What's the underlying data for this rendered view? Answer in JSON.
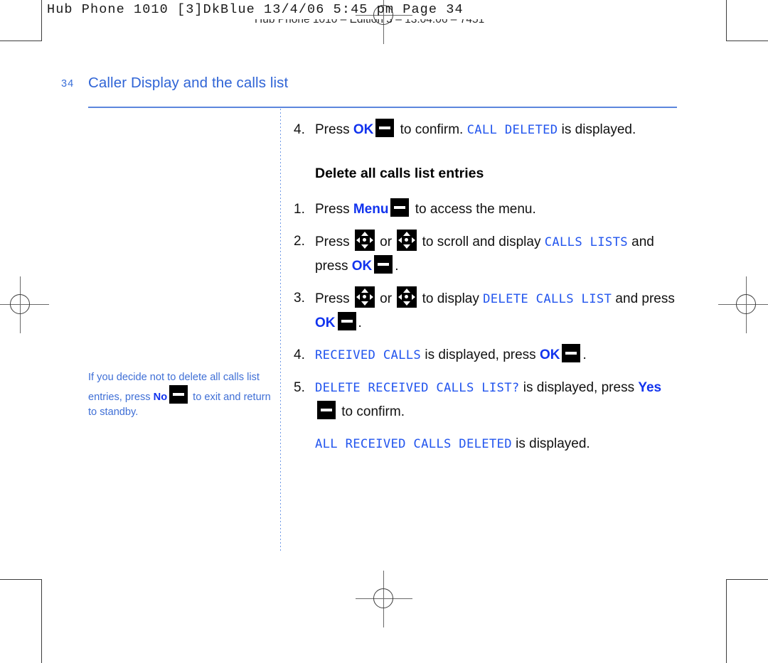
{
  "prepress": {
    "slug_primary": "Hub Phone 1010 [3]DkBlue  13/4/06  5:45 pm  Page 34",
    "slug_secondary": "Hub Phone 1010 – Edition 3 – 13.04.06 – 7451",
    "marks": {
      "registration": "registration-crosshair",
      "crop": "corner-crop-box"
    }
  },
  "colors": {
    "accent_blue": "#2f64d6",
    "key_blue": "#1133ee",
    "lcd_blue": "#2255ee",
    "rule_blue": "#5c86dd",
    "sidenote_blue": "#3f6fd6",
    "key_black": "#000000"
  },
  "header": {
    "folio": "34",
    "chapter_title": "Caller Display and the calls list"
  },
  "sidenote": {
    "part1": "If you decide not to delete all calls list entries, press ",
    "key_label": "No",
    "part2": " to exit and return to standby."
  },
  "main": {
    "intro_step": {
      "num": "4.",
      "p1": "Press ",
      "key1": "OK",
      "p2": " to confirm. ",
      "lcd1": "CALL DELETED",
      "p3": " is displayed."
    },
    "section_heading": "Delete all calls list entries",
    "steps": [
      {
        "num": "1.",
        "p1": "Press ",
        "key1": "Menu",
        "p2": " to access the menu."
      },
      {
        "num": "2.",
        "p1": "Press ",
        "p2": " or ",
        "p3": " to scroll and display ",
        "lcd1": "CALLS LISTS",
        "p4": " and press ",
        "key1": "OK",
        "p5": "."
      },
      {
        "num": "3.",
        "p1": "Press ",
        "p2": " or ",
        "p3": " to display ",
        "lcd1": "DELETE CALLS LIST",
        "p4": " and press ",
        "key1": "OK",
        "p5": "."
      },
      {
        "num": "4.",
        "lcd1": "RECEIVED CALLS",
        "p1": " is displayed, press ",
        "key1": "OK",
        "p2": "."
      },
      {
        "num": "5.",
        "lcd1": "DELETE RECEIVED CALLS LIST?",
        "p1": " is displayed, press ",
        "key1": "Yes",
        "p2": " to confirm."
      }
    ],
    "closing_paragraph": {
      "lcd1": "ALL RECEIVED CALLS DELETED",
      "p1": " is displayed."
    }
  }
}
